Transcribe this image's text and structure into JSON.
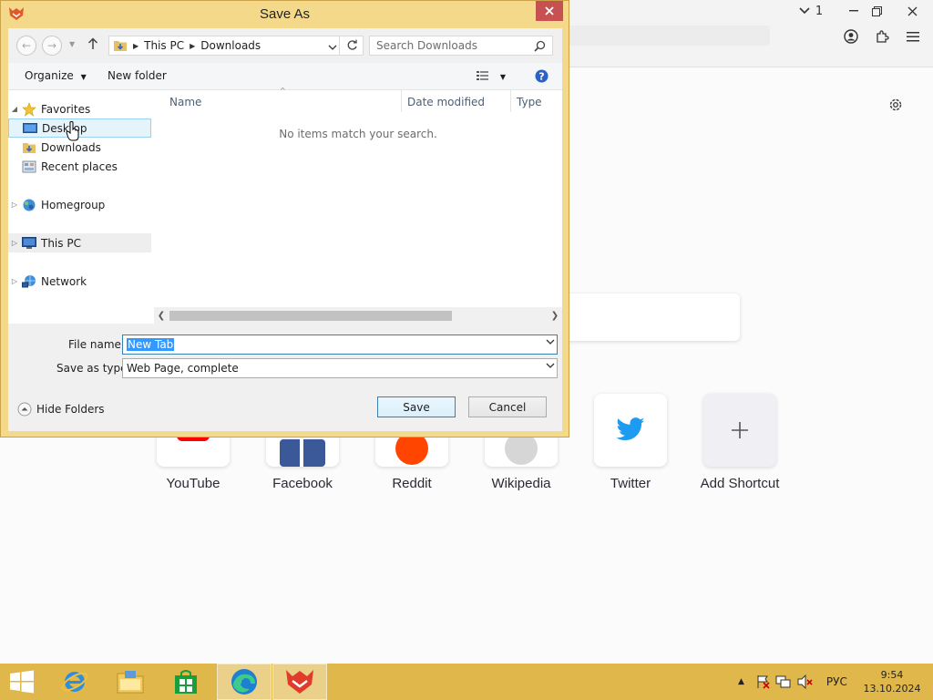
{
  "browser": {
    "tab_count": "1",
    "shortcuts": [
      {
        "label": "YouTube",
        "icon": "youtube-icon"
      },
      {
        "label": "Facebook",
        "icon": "facebook-icon"
      },
      {
        "label": "Reddit",
        "icon": "reddit-icon"
      },
      {
        "label": "Wikipedia",
        "icon": "wikipedia-icon"
      },
      {
        "label": "Twitter",
        "icon": "twitter-icon"
      },
      {
        "label": "Add Shortcut",
        "icon": "plus-icon"
      }
    ]
  },
  "dialog": {
    "title": "Save As",
    "breadcrumb": [
      "This PC",
      "Downloads"
    ],
    "search_placeholder": "Search Downloads",
    "organize_label": "Organize",
    "new_folder_label": "New folder",
    "nav": {
      "favorites": "Favorites",
      "desktop": "Desktop",
      "downloads": "Downloads",
      "recent": "Recent places",
      "homegroup": "Homegroup",
      "this_pc": "This PC",
      "network": "Network"
    },
    "columns": {
      "name": "Name",
      "date_modified": "Date modified",
      "type": "Type"
    },
    "empty_message": "No items match your search.",
    "file_name_label": "File name:",
    "file_name_value": "New Tab",
    "save_type_label": "Save as type:",
    "save_type_value": "Web Page, complete",
    "hide_folders_label": "Hide Folders",
    "save_label": "Save",
    "cancel_label": "Cancel"
  },
  "taskbar": {
    "language": "РУС",
    "time": "9:54",
    "date": "13.10.2024"
  },
  "colors": {
    "dialog_frame": "#f5d98a",
    "taskbar": "#e0b74a",
    "close_button": "#c75050",
    "selection": "#3399ff"
  }
}
